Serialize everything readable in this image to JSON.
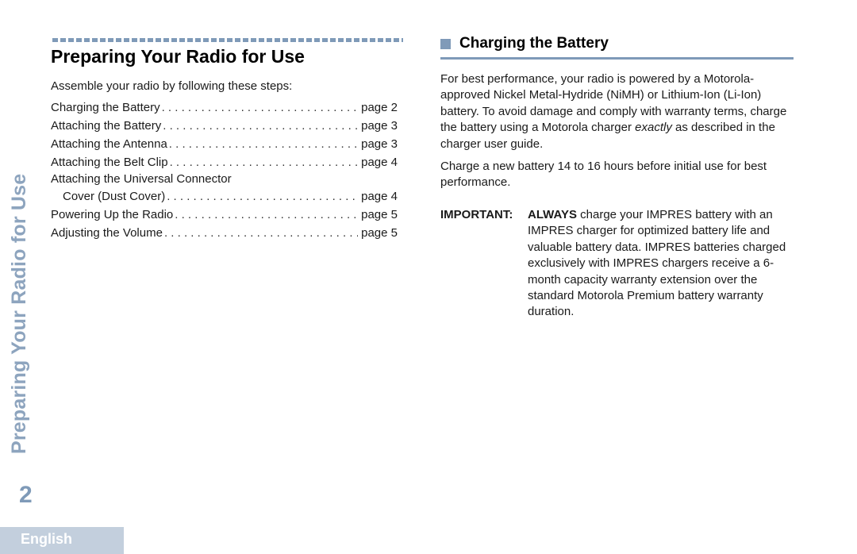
{
  "left": {
    "title": "Preparing Your Radio for Use",
    "intro": "Assemble your radio by following these steps:",
    "toc": [
      {
        "label": "Charging the Battery",
        "page": "page 2"
      },
      {
        "label": "Attaching the Battery",
        "page": "page 3"
      },
      {
        "label": "Attaching the Antenna",
        "page": "page 3"
      },
      {
        "label": "Attaching the Belt Clip",
        "page": "page 4"
      },
      {
        "label": "Attaching the Universal Connector",
        "label_cont": "Cover (Dust Cover)",
        "page": "page 4"
      },
      {
        "label": "Powering Up the Radio",
        "page": "page 5"
      },
      {
        "label": "Adjusting the Volume",
        "page": "page 5"
      }
    ]
  },
  "right": {
    "heading": "Charging the Battery",
    "heading_icon": "square-bullet-icon",
    "paragraph1_pre": "For best performance, your radio is powered by a Motorola-approved Nickel Metal-Hydride (NiMH) or Lithium-Ion (Li-Ion) battery. To avoid damage and comply with warranty terms, charge the battery using a Motorola charger ",
    "paragraph1_em": "exactly",
    "paragraph1_post": " as described in the charger user guide.",
    "paragraph2": "Charge a new battery 14 to 16 hours before initial use for best performance.",
    "important": {
      "label": "IMPORTANT:",
      "bold_lead": "ALWAYS",
      "text": " charge your IMPRES battery with an IMPRES charger for optimized battery life and valuable battery data. IMPRES batteries charged exclusively with IMPRES chargers receive a 6-month capacity warranty extension over the standard Motorola Premium battery warranty duration."
    }
  },
  "side_title": "Preparing Your Radio for Use",
  "page_number": "2",
  "language_tab": "English",
  "colors": {
    "accent": "#7f9ab8",
    "side_title": "#8da4be",
    "language_tab_bg": "#c3cfdd"
  }
}
